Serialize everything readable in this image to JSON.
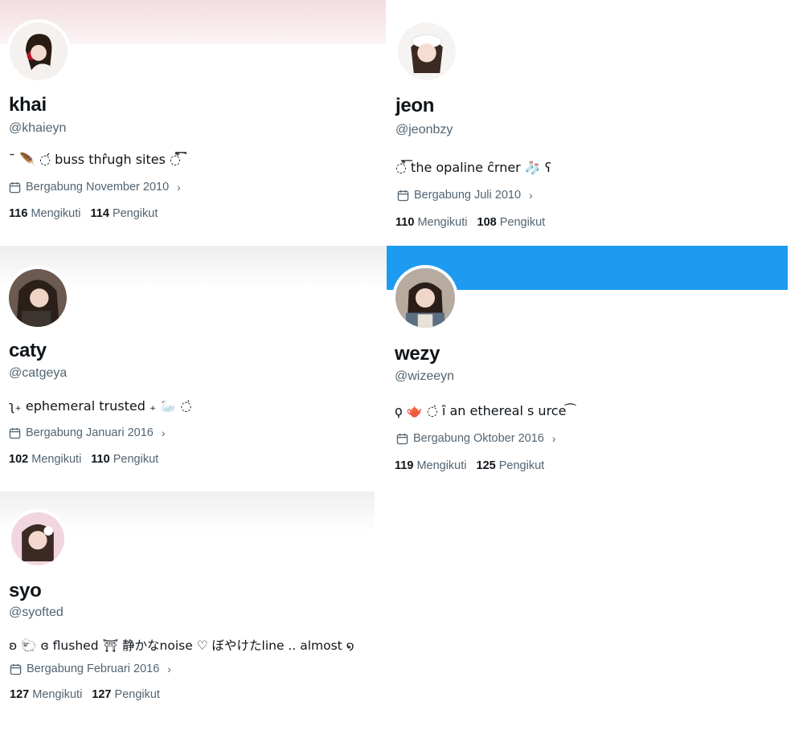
{
  "colors": {
    "blue_banner": "#1d9bf0",
    "pink_banner": "#f4dfe1",
    "text_secondary": "#536471",
    "text_primary": "#0f1419"
  },
  "profiles": [
    {
      "display_name": "khai",
      "handle": "@khaieyn",
      "bio": "˜ 🪶 ◌́ buss thr̂ugh sites ◌͒͞͡",
      "joined": "Bergabung November 2010",
      "following_count": "116",
      "following_label": "Mengikuti",
      "followers_count": "114",
      "followers_label": "Pengikut"
    },
    {
      "display_name": "jeon",
      "handle": "@jeonbzy",
      "bio": "◌͒͞ the opaline c̑rner 🧦 ʕ",
      "joined": "Bergabung Juli 2010",
      "following_count": "110",
      "following_label": "Mengikuti",
      "followers_count": "108",
      "followers_label": "Pengikut"
    },
    {
      "display_name": "caty",
      "handle": "@catgeya",
      "bio": "ʅ₊ ephemeral trusted ₊ 🦢 ◌̇",
      "joined": "Bergabung Januari 2016",
      "following_count": "102",
      "following_label": "Mengikuti",
      "followers_count": "110",
      "followers_label": "Pengikut"
    },
    {
      "display_name": "wezy",
      "handle": "@wizeeyn",
      "bio": "ϙ 🫖 ◌̇ ȋ an ethereal s urce ͡",
      "joined": "Bergabung Oktober 2016",
      "following_count": "119",
      "following_label": "Mengikuti",
      "followers_count": "125",
      "followers_label": "Pengikut"
    },
    {
      "display_name": "syo",
      "handle": "@syofted",
      "bio": "ʚ 🐑 ɞ flushed ⛩ 静かなnoise ♡ ぼやけたline .. almost ໑",
      "joined": "Bergabung Februari 2016",
      "following_count": "127",
      "following_label": "Mengikuti",
      "followers_count": "127",
      "followers_label": "Pengikut"
    }
  ],
  "icons": {
    "calendar": "calendar-icon",
    "chevron": "chevron-right-icon"
  }
}
